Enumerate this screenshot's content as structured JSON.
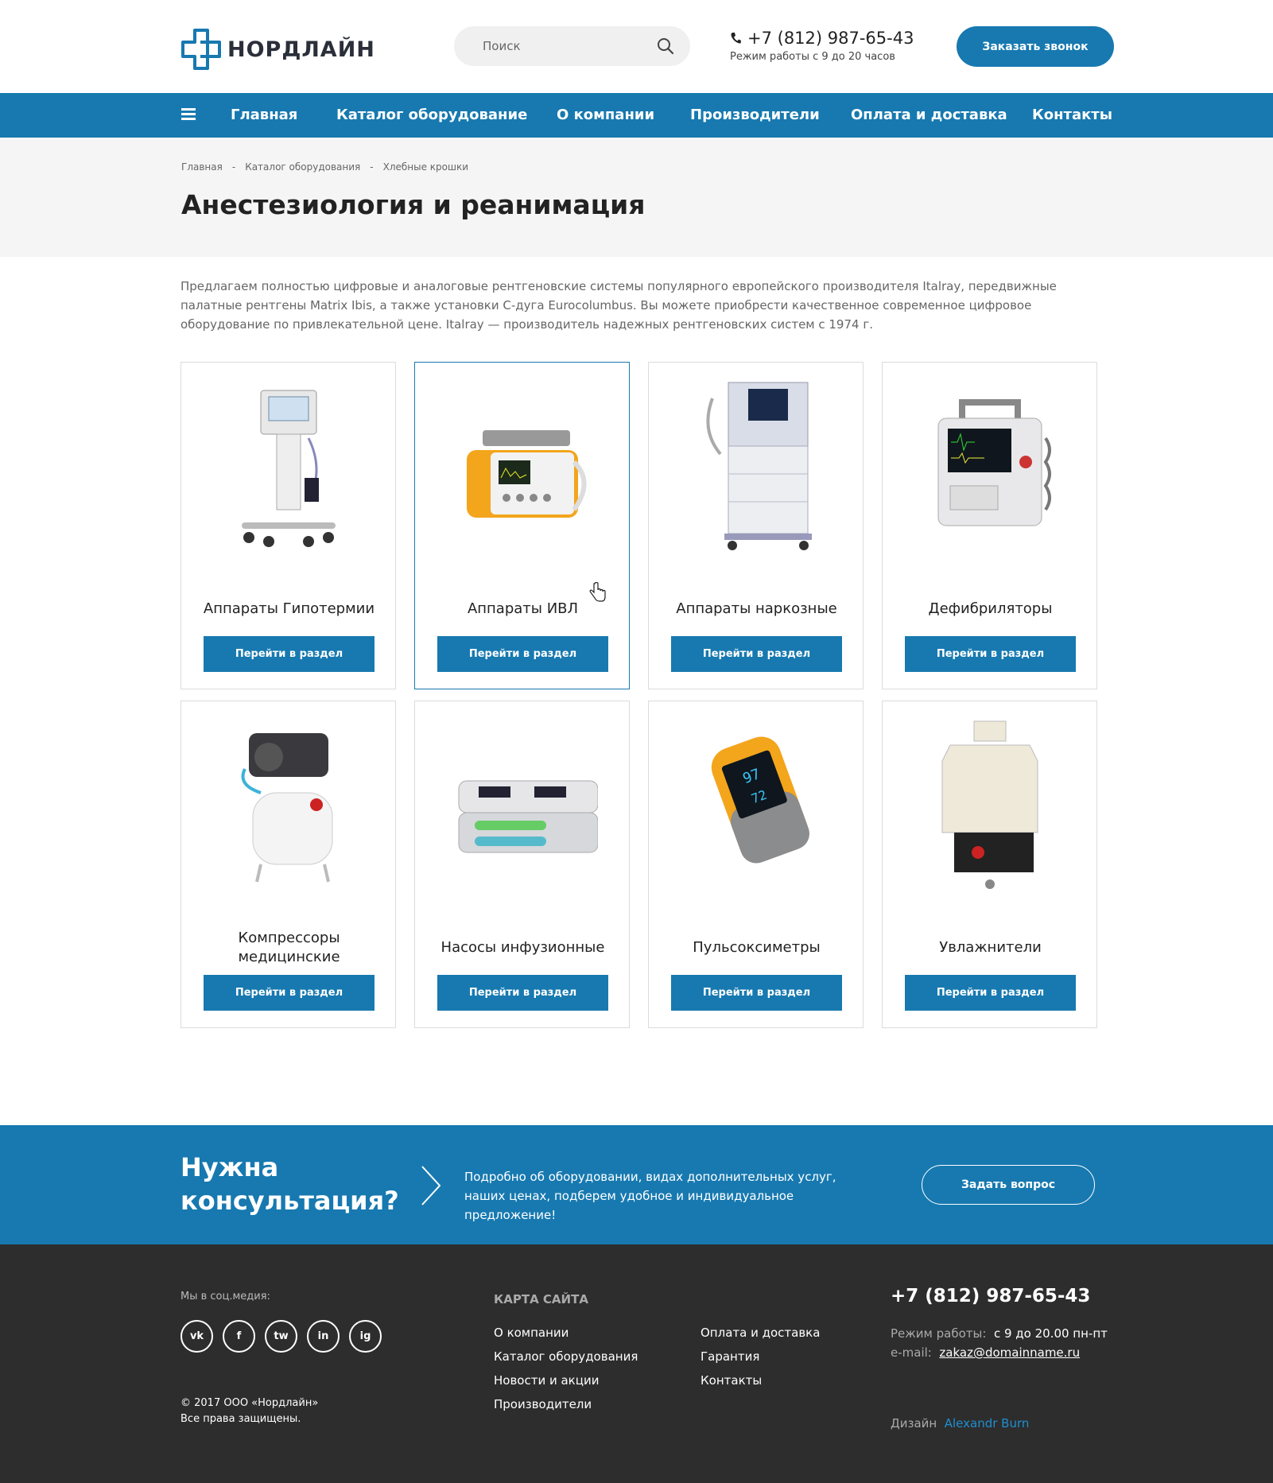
{
  "header": {
    "logo_text": "НОРДЛАЙН",
    "search_placeholder": "Поиск",
    "phone": "+7 (812) 987-65-43",
    "hours": "Режим работы с 9 до 20 часов",
    "callback_label": "Заказать звонок"
  },
  "nav": {
    "items": [
      {
        "label": "Главная"
      },
      {
        "label": "Каталог оборудование"
      },
      {
        "label": "О компании"
      },
      {
        "label": "Производители"
      },
      {
        "label": "Оплата и доставка"
      },
      {
        "label": "Контакты"
      }
    ]
  },
  "breadcrumb": {
    "items": [
      "Главная",
      "Каталог оборудования",
      "Хлебные крошки"
    ],
    "separator": "-"
  },
  "page": {
    "title": "Анестезиология и реанимация",
    "intro": "Предлагаем полностью цифровые и аналоговые рентгеновские системы популярного европейского производителя Italray, передвижные палатные рентгены Matrix Ibis, а также установки C-дуга Eurocolumbus. Вы можете приобрести качественное современное цифровое оборудование по привлекательной цене. Italray — производитель надежных рентгеновских систем с 1974 г."
  },
  "catalog": {
    "button_label": "Перейти в раздел",
    "cards": [
      {
        "title": "Аппараты Гипотермии",
        "icon": "hypothermia-device-image"
      },
      {
        "title": "Аппараты ИВЛ",
        "icon": "ventilator-image"
      },
      {
        "title": "Аппараты наркозные",
        "icon": "anesthesia-machine-image"
      },
      {
        "title": "Дефибриляторы",
        "icon": "defibrillator-image"
      },
      {
        "title": "Компрессоры медицинские",
        "icon": "compressor-image"
      },
      {
        "title": "Насосы инфузионные",
        "icon": "infusion-pump-image"
      },
      {
        "title": "Пульсоксиметры",
        "icon": "pulse-oximeter-image"
      },
      {
        "title": "Увлажнители",
        "icon": "humidifier-image"
      }
    ]
  },
  "consult": {
    "title": "Нужна консультация?",
    "text": "Подробно об оборудовании, видах дополнительных услуг, наших ценах, подберем удобное и индивидуальное предложение!",
    "button_label": "Задать вопрос"
  },
  "footer": {
    "social_label": "Мы в соц.медия:",
    "socials": [
      "vk",
      "f",
      "tw",
      "in",
      "ig"
    ],
    "copyright_line1": "© 2017  ООО «Нордлайн»",
    "copyright_line2": "Все права защищены.",
    "sitemap_title": "КАРТА САЙТА",
    "sitemap_col1": [
      "О компании",
      "Каталог оборудования",
      "Новости и акции",
      "Производители"
    ],
    "sitemap_col2": [
      "Оплата и доставка",
      "Гарантия",
      "Контакты"
    ],
    "phone": "+7 (812) 987-65-43",
    "hours_label": "Режим работы:",
    "hours_value": "с 9 до 20.00 пн-пт",
    "email_label": "e-mail:",
    "email_value": "zakaz@domainname.ru",
    "design_label": "Дизайн",
    "design_author": "Alexandr Burn"
  },
  "colors": {
    "brand_blue": "#1779b0",
    "footer_bg": "#2d2d2d",
    "title_band_bg": "#f5f5f5"
  }
}
